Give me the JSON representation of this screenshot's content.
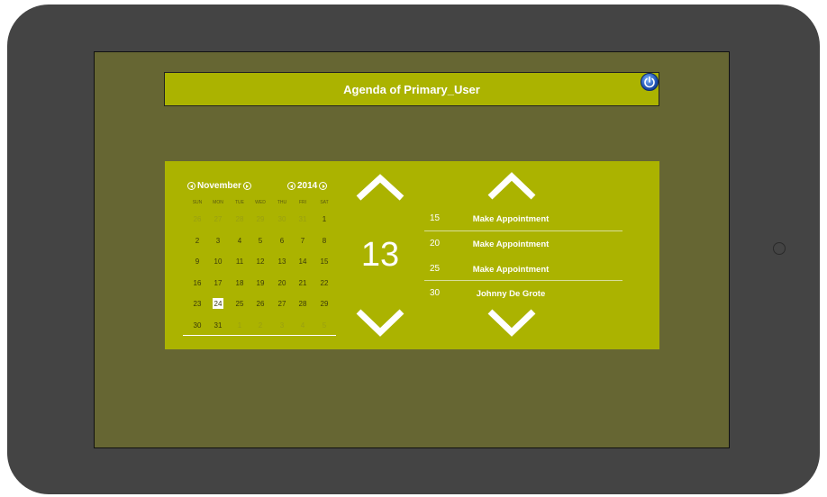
{
  "header": {
    "title": "Agenda of Primary_User"
  },
  "calendar": {
    "month": "November",
    "year": "2014",
    "weekdays": [
      "SUN",
      "MON",
      "TUE",
      "WED",
      "THU",
      "FRI",
      "SAT"
    ],
    "weeks": [
      [
        "26",
        "27",
        "28",
        "29",
        "30",
        "31",
        "1"
      ],
      [
        "2",
        "3",
        "4",
        "5",
        "6",
        "7",
        "8"
      ],
      [
        "9",
        "10",
        "11",
        "12",
        "13",
        "14",
        "15"
      ],
      [
        "16",
        "17",
        "18",
        "19",
        "20",
        "21",
        "22"
      ],
      [
        "23",
        "24",
        "25",
        "26",
        "27",
        "28",
        "29"
      ],
      [
        "30",
        "31",
        "1",
        "2",
        "3",
        "4",
        "5"
      ]
    ],
    "selected_day": "24"
  },
  "time_picker": {
    "value": "13"
  },
  "appointments": [
    {
      "time": "15",
      "label": "Make Appointment"
    },
    {
      "time": "20",
      "label": "Make Appointment"
    },
    {
      "time": "25",
      "label": "Make Appointment"
    },
    {
      "time": "30",
      "label": "Johnny De Grote"
    }
  ],
  "icons": {
    "power": "power-icon",
    "prev_month": "chevron-left-circle-icon",
    "next_month": "chevron-right-circle-icon",
    "up": "chevron-up-icon",
    "down": "chevron-down-icon"
  },
  "colors": {
    "panel": "#abb300",
    "screen": "#666633",
    "device": "#444444"
  }
}
